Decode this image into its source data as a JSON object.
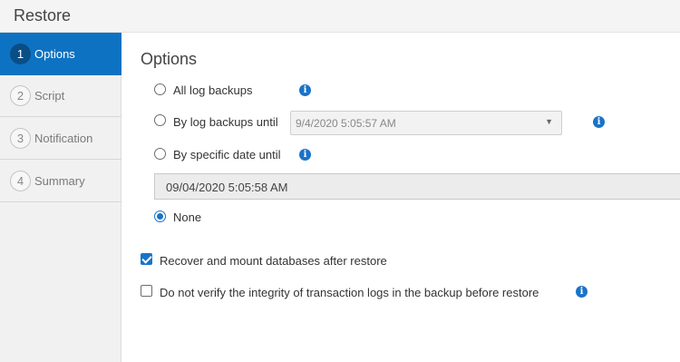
{
  "header": {
    "title": "Restore"
  },
  "sidebar": {
    "steps": [
      {
        "number": "1",
        "label": "Options"
      },
      {
        "number": "2",
        "label": "Script"
      },
      {
        "number": "3",
        "label": "Notification"
      },
      {
        "number": "4",
        "label": "Summary"
      }
    ],
    "active_step": "Options"
  },
  "main": {
    "title": "Options",
    "radios": {
      "all_log_backups": {
        "label": "All log backups",
        "checked": false
      },
      "by_log_backups_until": {
        "label": "By log backups until",
        "checked": false,
        "select_value": "9/4/2020 5:05:57 AM"
      },
      "by_specific_date_until": {
        "label": "By specific date until",
        "checked": false,
        "date_value": "09/04/2020 5:05:58 AM"
      },
      "none": {
        "label": "None",
        "checked": true
      }
    },
    "checkboxes": {
      "recover_mount": {
        "label": "Recover and mount databases after restore",
        "checked": true
      },
      "no_verify": {
        "label": "Do not verify the integrity of transaction logs in the backup before restore",
        "checked": false
      }
    },
    "icons": {
      "info": "info-icon",
      "dropdown": "chevron-down-icon"
    },
    "info_glyph": "i",
    "caret_glyph": "▼"
  },
  "colors": {
    "accent": "#0d72c2",
    "info": "#1a73c8"
  }
}
